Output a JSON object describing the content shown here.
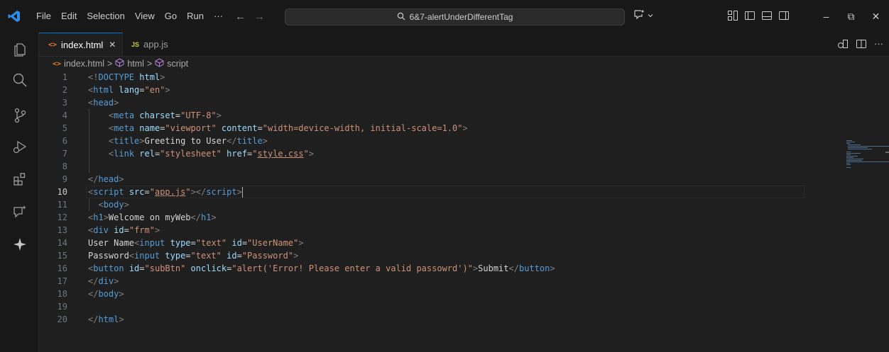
{
  "titlebar": {
    "menu": [
      "File",
      "Edit",
      "Selection",
      "View",
      "Go",
      "Run",
      "···"
    ],
    "search_text": "6&7-alertUnderDifferentTag",
    "back_arrow": "←",
    "forward_arrow": "→",
    "window_controls": {
      "minimize": "–",
      "restore": "⧉",
      "close": "✕"
    }
  },
  "tabs": [
    {
      "icon": "<>",
      "label": "index.html",
      "close": "✕",
      "active": true,
      "icon_color": "#e37933"
    },
    {
      "icon": "JS",
      "label": "app.js",
      "active": false,
      "icon_color": "#cbcb41"
    }
  ],
  "tab_actions": {
    "more": "···"
  },
  "breadcrumb": {
    "file": "index.html",
    "sep": ">",
    "items": [
      "html",
      "script"
    ]
  },
  "editor": {
    "current_line": 10,
    "lines": [
      {
        "n": "1",
        "segs": [
          [
            "punc",
            "<!"
          ],
          [
            "tag",
            "DOCTYPE"
          ],
          [
            "text",
            " "
          ],
          [
            "attr",
            "html"
          ],
          [
            "punc",
            ">"
          ]
        ]
      },
      {
        "n": "2",
        "segs": [
          [
            "punc",
            "<"
          ],
          [
            "tag",
            "html"
          ],
          [
            "text",
            " "
          ],
          [
            "attr",
            "lang"
          ],
          [
            "text",
            "="
          ],
          [
            "str",
            "\"en\""
          ],
          [
            "punc",
            ">"
          ]
        ]
      },
      {
        "n": "3",
        "segs": [
          [
            "punc",
            "<"
          ],
          [
            "tag",
            "head"
          ],
          [
            "punc",
            ">"
          ]
        ]
      },
      {
        "n": "4",
        "segs": [
          [
            "text",
            "    "
          ],
          [
            "punc",
            "<"
          ],
          [
            "tag",
            "meta"
          ],
          [
            "text",
            " "
          ],
          [
            "attr",
            "charset"
          ],
          [
            "text",
            "="
          ],
          [
            "str",
            "\"UTF-8\""
          ],
          [
            "punc",
            ">"
          ]
        ]
      },
      {
        "n": "5",
        "segs": [
          [
            "text",
            "    "
          ],
          [
            "punc",
            "<"
          ],
          [
            "tag",
            "meta"
          ],
          [
            "text",
            " "
          ],
          [
            "attr",
            "name"
          ],
          [
            "text",
            "="
          ],
          [
            "str",
            "\"viewport\""
          ],
          [
            "text",
            " "
          ],
          [
            "attr",
            "content"
          ],
          [
            "text",
            "="
          ],
          [
            "str",
            "\"width=device-width, initial-scale=1.0\""
          ],
          [
            "punc",
            ">"
          ]
        ]
      },
      {
        "n": "6",
        "segs": [
          [
            "text",
            "    "
          ],
          [
            "punc",
            "<"
          ],
          [
            "tag",
            "title"
          ],
          [
            "punc",
            ">"
          ],
          [
            "text",
            "Greeting to User"
          ],
          [
            "punc",
            "</"
          ],
          [
            "tag",
            "title"
          ],
          [
            "punc",
            ">"
          ]
        ]
      },
      {
        "n": "7",
        "segs": [
          [
            "text",
            "    "
          ],
          [
            "punc",
            "<"
          ],
          [
            "tag",
            "link"
          ],
          [
            "text",
            " "
          ],
          [
            "attr",
            "rel"
          ],
          [
            "text",
            "="
          ],
          [
            "str",
            "\"stylesheet\""
          ],
          [
            "text",
            " "
          ],
          [
            "attr",
            "href"
          ],
          [
            "text",
            "="
          ],
          [
            "str",
            "\""
          ],
          [
            "link",
            "style.css"
          ],
          [
            "str",
            "\""
          ],
          [
            "punc",
            ">"
          ]
        ]
      },
      {
        "n": "8",
        "segs": []
      },
      {
        "n": "9",
        "segs": [
          [
            "punc",
            "</"
          ],
          [
            "tag",
            "head"
          ],
          [
            "punc",
            ">"
          ]
        ]
      },
      {
        "n": "10",
        "segs": [
          [
            "punc",
            "<"
          ],
          [
            "tag",
            "script"
          ],
          [
            "text",
            " "
          ],
          [
            "attr",
            "src"
          ],
          [
            "text",
            "="
          ],
          [
            "str",
            "\""
          ],
          [
            "link",
            "app.js"
          ],
          [
            "str",
            "\""
          ],
          [
            "punc",
            "></"
          ],
          [
            "tag",
            "script"
          ],
          [
            "punc",
            ">"
          ],
          [
            "cursor",
            ""
          ]
        ]
      },
      {
        "n": "11",
        "segs": [
          [
            "text",
            "  "
          ],
          [
            "punc",
            "<"
          ],
          [
            "tag",
            "body"
          ],
          [
            "punc",
            ">"
          ]
        ]
      },
      {
        "n": "12",
        "segs": [
          [
            "punc",
            "<"
          ],
          [
            "tag",
            "h1"
          ],
          [
            "punc",
            ">"
          ],
          [
            "text",
            "Welcome on myWeb"
          ],
          [
            "punc",
            "</"
          ],
          [
            "tag",
            "h1"
          ],
          [
            "punc",
            ">"
          ]
        ]
      },
      {
        "n": "13",
        "segs": [
          [
            "punc",
            "<"
          ],
          [
            "tag",
            "div"
          ],
          [
            "text",
            " "
          ],
          [
            "attr",
            "id"
          ],
          [
            "text",
            "="
          ],
          [
            "str",
            "\"frm\""
          ],
          [
            "punc",
            ">"
          ]
        ]
      },
      {
        "n": "14",
        "segs": [
          [
            "text",
            "User Name"
          ],
          [
            "punc",
            "<"
          ],
          [
            "tag",
            "input"
          ],
          [
            "text",
            " "
          ],
          [
            "attr",
            "type"
          ],
          [
            "text",
            "="
          ],
          [
            "str",
            "\"text\""
          ],
          [
            "text",
            " "
          ],
          [
            "attr",
            "id"
          ],
          [
            "text",
            "="
          ],
          [
            "str",
            "\"UserName\""
          ],
          [
            "punc",
            ">"
          ]
        ]
      },
      {
        "n": "15",
        "segs": [
          [
            "text",
            "Password"
          ],
          [
            "punc",
            "<"
          ],
          [
            "tag",
            "input"
          ],
          [
            "text",
            " "
          ],
          [
            "attr",
            "type"
          ],
          [
            "text",
            "="
          ],
          [
            "str",
            "\"text\""
          ],
          [
            "text",
            " "
          ],
          [
            "attr",
            "id"
          ],
          [
            "text",
            "="
          ],
          [
            "str",
            "\"Password\""
          ],
          [
            "punc",
            ">"
          ]
        ]
      },
      {
        "n": "16",
        "segs": [
          [
            "punc",
            "<"
          ],
          [
            "tag",
            "button"
          ],
          [
            "text",
            " "
          ],
          [
            "attr",
            "id"
          ],
          [
            "text",
            "="
          ],
          [
            "str",
            "\"subBtn\""
          ],
          [
            "text",
            " "
          ],
          [
            "attr",
            "onclick"
          ],
          [
            "text",
            "="
          ],
          [
            "str",
            "\"alert('Error! Please enter a valid passowrd')\""
          ],
          [
            "punc",
            ">"
          ],
          [
            "text",
            "Submit"
          ],
          [
            "punc",
            "</"
          ],
          [
            "tag",
            "button"
          ],
          [
            "punc",
            ">"
          ]
        ]
      },
      {
        "n": "17",
        "segs": [
          [
            "punc",
            "</"
          ],
          [
            "tag",
            "div"
          ],
          [
            "punc",
            ">"
          ]
        ]
      },
      {
        "n": "18",
        "segs": [
          [
            "punc",
            "</"
          ],
          [
            "tag",
            "body"
          ],
          [
            "punc",
            ">"
          ]
        ]
      },
      {
        "n": "19",
        "segs": []
      },
      {
        "n": "20",
        "segs": [
          [
            "punc",
            "</"
          ],
          [
            "tag",
            "html"
          ],
          [
            "punc",
            ">"
          ]
        ]
      }
    ]
  },
  "colors": {
    "accent": "#0078d4",
    "tag": "#569cd6",
    "attr": "#9cdcfe",
    "string": "#ce9178",
    "punctuation": "#808080",
    "text": "#d4d4d4"
  }
}
